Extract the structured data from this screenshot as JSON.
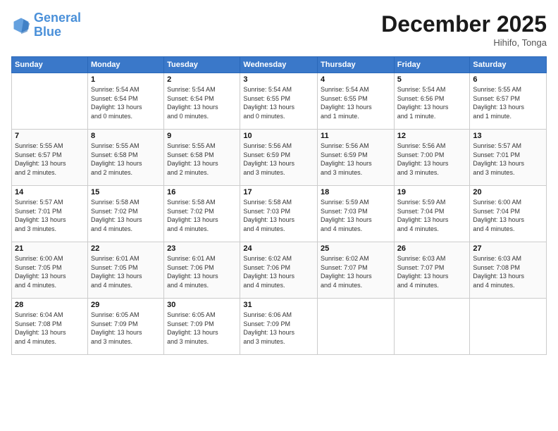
{
  "logo": {
    "line1": "General",
    "line2": "Blue"
  },
  "title": "December 2025",
  "location": "Hihifo, Tonga",
  "days_header": [
    "Sunday",
    "Monday",
    "Tuesday",
    "Wednesday",
    "Thursday",
    "Friday",
    "Saturday"
  ],
  "weeks": [
    [
      {
        "day": "",
        "info": ""
      },
      {
        "day": "1",
        "info": "Sunrise: 5:54 AM\nSunset: 6:54 PM\nDaylight: 13 hours\nand 0 minutes."
      },
      {
        "day": "2",
        "info": "Sunrise: 5:54 AM\nSunset: 6:54 PM\nDaylight: 13 hours\nand 0 minutes."
      },
      {
        "day": "3",
        "info": "Sunrise: 5:54 AM\nSunset: 6:55 PM\nDaylight: 13 hours\nand 0 minutes."
      },
      {
        "day": "4",
        "info": "Sunrise: 5:54 AM\nSunset: 6:55 PM\nDaylight: 13 hours\nand 1 minute."
      },
      {
        "day": "5",
        "info": "Sunrise: 5:54 AM\nSunset: 6:56 PM\nDaylight: 13 hours\nand 1 minute."
      },
      {
        "day": "6",
        "info": "Sunrise: 5:55 AM\nSunset: 6:57 PM\nDaylight: 13 hours\nand 1 minute."
      }
    ],
    [
      {
        "day": "7",
        "info": "Sunrise: 5:55 AM\nSunset: 6:57 PM\nDaylight: 13 hours\nand 2 minutes."
      },
      {
        "day": "8",
        "info": "Sunrise: 5:55 AM\nSunset: 6:58 PM\nDaylight: 13 hours\nand 2 minutes."
      },
      {
        "day": "9",
        "info": "Sunrise: 5:55 AM\nSunset: 6:58 PM\nDaylight: 13 hours\nand 2 minutes."
      },
      {
        "day": "10",
        "info": "Sunrise: 5:56 AM\nSunset: 6:59 PM\nDaylight: 13 hours\nand 3 minutes."
      },
      {
        "day": "11",
        "info": "Sunrise: 5:56 AM\nSunset: 6:59 PM\nDaylight: 13 hours\nand 3 minutes."
      },
      {
        "day": "12",
        "info": "Sunrise: 5:56 AM\nSunset: 7:00 PM\nDaylight: 13 hours\nand 3 minutes."
      },
      {
        "day": "13",
        "info": "Sunrise: 5:57 AM\nSunset: 7:01 PM\nDaylight: 13 hours\nand 3 minutes."
      }
    ],
    [
      {
        "day": "14",
        "info": "Sunrise: 5:57 AM\nSunset: 7:01 PM\nDaylight: 13 hours\nand 3 minutes."
      },
      {
        "day": "15",
        "info": "Sunrise: 5:58 AM\nSunset: 7:02 PM\nDaylight: 13 hours\nand 4 minutes."
      },
      {
        "day": "16",
        "info": "Sunrise: 5:58 AM\nSunset: 7:02 PM\nDaylight: 13 hours\nand 4 minutes."
      },
      {
        "day": "17",
        "info": "Sunrise: 5:58 AM\nSunset: 7:03 PM\nDaylight: 13 hours\nand 4 minutes."
      },
      {
        "day": "18",
        "info": "Sunrise: 5:59 AM\nSunset: 7:03 PM\nDaylight: 13 hours\nand 4 minutes."
      },
      {
        "day": "19",
        "info": "Sunrise: 5:59 AM\nSunset: 7:04 PM\nDaylight: 13 hours\nand 4 minutes."
      },
      {
        "day": "20",
        "info": "Sunrise: 6:00 AM\nSunset: 7:04 PM\nDaylight: 13 hours\nand 4 minutes."
      }
    ],
    [
      {
        "day": "21",
        "info": "Sunrise: 6:00 AM\nSunset: 7:05 PM\nDaylight: 13 hours\nand 4 minutes."
      },
      {
        "day": "22",
        "info": "Sunrise: 6:01 AM\nSunset: 7:05 PM\nDaylight: 13 hours\nand 4 minutes."
      },
      {
        "day": "23",
        "info": "Sunrise: 6:01 AM\nSunset: 7:06 PM\nDaylight: 13 hours\nand 4 minutes."
      },
      {
        "day": "24",
        "info": "Sunrise: 6:02 AM\nSunset: 7:06 PM\nDaylight: 13 hours\nand 4 minutes."
      },
      {
        "day": "25",
        "info": "Sunrise: 6:02 AM\nSunset: 7:07 PM\nDaylight: 13 hours\nand 4 minutes."
      },
      {
        "day": "26",
        "info": "Sunrise: 6:03 AM\nSunset: 7:07 PM\nDaylight: 13 hours\nand 4 minutes."
      },
      {
        "day": "27",
        "info": "Sunrise: 6:03 AM\nSunset: 7:08 PM\nDaylight: 13 hours\nand 4 minutes."
      }
    ],
    [
      {
        "day": "28",
        "info": "Sunrise: 6:04 AM\nSunset: 7:08 PM\nDaylight: 13 hours\nand 4 minutes."
      },
      {
        "day": "29",
        "info": "Sunrise: 6:05 AM\nSunset: 7:09 PM\nDaylight: 13 hours\nand 3 minutes."
      },
      {
        "day": "30",
        "info": "Sunrise: 6:05 AM\nSunset: 7:09 PM\nDaylight: 13 hours\nand 3 minutes."
      },
      {
        "day": "31",
        "info": "Sunrise: 6:06 AM\nSunset: 7:09 PM\nDaylight: 13 hours\nand 3 minutes."
      },
      {
        "day": "",
        "info": ""
      },
      {
        "day": "",
        "info": ""
      },
      {
        "day": "",
        "info": ""
      }
    ]
  ]
}
